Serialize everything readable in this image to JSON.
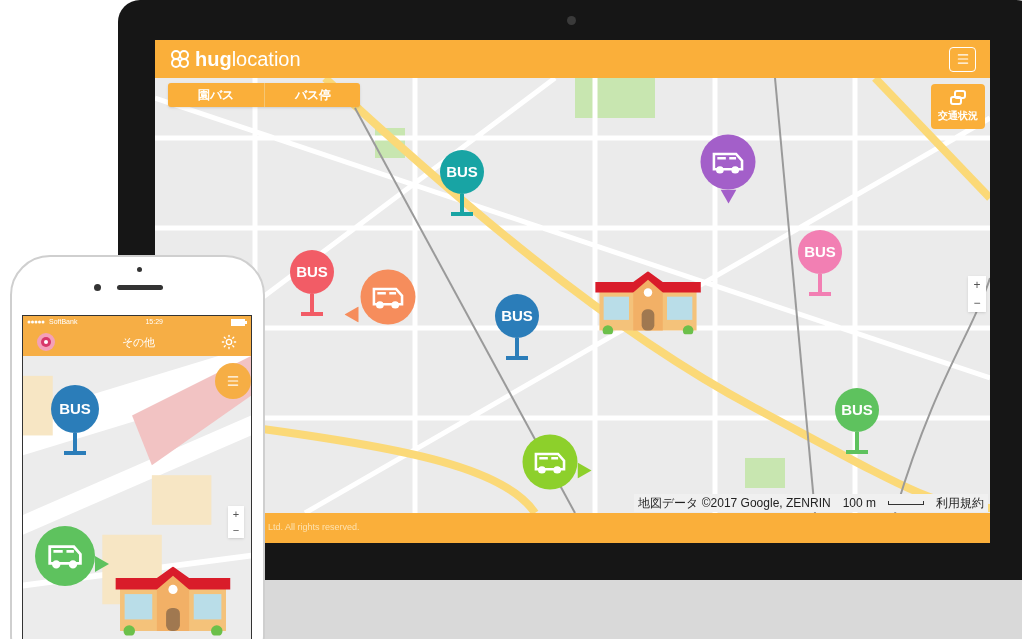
{
  "monitor": {
    "logo_bold": "hug",
    "logo_rest": "location",
    "tabs": [
      {
        "label": "園バス"
      },
      {
        "label": "バス停"
      }
    ],
    "traffic_button": "交通状況",
    "zoom_controls": [
      "+",
      "−"
    ],
    "markers": [
      {
        "kind": "stop",
        "label": "BUS",
        "color": "#18a4a4"
      },
      {
        "kind": "bus-down",
        "color": "#a35fc9"
      },
      {
        "kind": "stop",
        "label": "BUS",
        "color": "#f27fb3"
      },
      {
        "kind": "stop",
        "label": "BUS",
        "color": "#f25c66"
      },
      {
        "kind": "bus-left",
        "color": "#f68d5c"
      },
      {
        "kind": "stop",
        "label": "BUS",
        "color": "#2b7db9"
      },
      {
        "kind": "stop",
        "label": "BUS",
        "color": "#5ec25e"
      },
      {
        "kind": "bus-right",
        "color": "#8dd02b"
      },
      {
        "kind": "school"
      }
    ],
    "attribution": {
      "map_data": "地図データ ©2017 Google, ZENRIN",
      "scale": "100 m",
      "terms": "利用規約"
    },
    "footer": "Ltd. All rights reserved."
  },
  "phone": {
    "carrier": "SoftBank",
    "time": "15:29",
    "title": "その他",
    "zoom_controls": [
      "+",
      "−"
    ],
    "markers": [
      {
        "kind": "stop",
        "label": "BUS",
        "color": "#2b7db9"
      },
      {
        "kind": "bus-right",
        "color": "#5ec25e"
      },
      {
        "kind": "school"
      }
    ]
  }
}
